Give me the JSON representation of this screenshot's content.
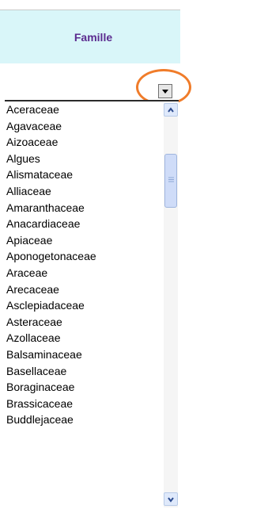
{
  "header": {
    "title": "Famille"
  },
  "families": [
    "Aceraceae",
    "Agavaceae",
    "Aizoaceae",
    "Algues",
    "Alismataceae",
    "Alliaceae",
    "Amaranthaceae",
    "Anacardiaceae",
    "Apiaceae",
    "Aponogetonaceae",
    "Araceae",
    "Arecaceae",
    "Asclepiadaceae",
    "Asteraceae",
    "Azollaceae",
    "Balsaminaceae",
    "Basellaceae",
    "Boraginaceae",
    "Brassicaceae",
    "Buddlejaceae"
  ],
  "icons": {
    "filter": "dropdown-arrow-icon",
    "scroll_up": "chevron-up-icon",
    "scroll_down": "chevron-down-icon",
    "thumb_grip": "grip-icon"
  },
  "colors": {
    "header_bg": "#d9f6f9",
    "header_text": "#5b2b8f",
    "highlight": "#f07c2a",
    "scroll_thumb": "#cfdcf8"
  }
}
